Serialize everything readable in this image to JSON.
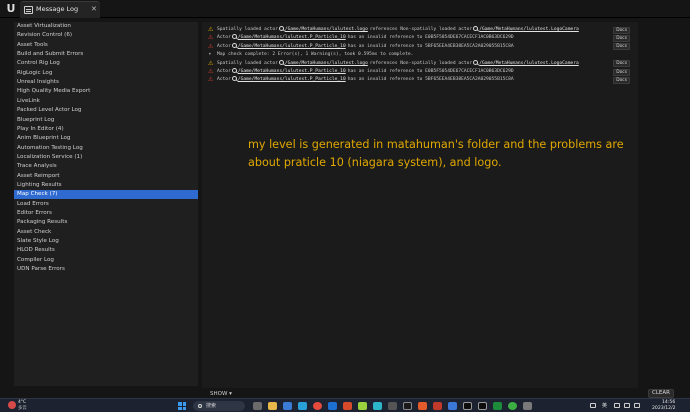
{
  "window": {
    "tab_label": "Message Log"
  },
  "sidebar": {
    "items": [
      "Asset Virtualization",
      "Revision Control (6)",
      "Asset Tools",
      "Build and Submit Errors",
      "Control Rig Log",
      "RigLogic Log",
      "Unreal Insights",
      "High Quality Media Export",
      "LiveLink",
      "Packed Level Actor Log",
      "Blueprint Log",
      "Play In Editor (4)",
      "Anim Blueprint Log",
      "Automation Testing Log",
      "Localization Service (1)",
      "Trace Analysis",
      "Asset Reimport",
      "Lighting Results",
      "Map Check (7)",
      "Load Errors",
      "Editor Errors",
      "Packaging Results",
      "Asset Check",
      "Slate Style Log",
      "HLOD Results",
      "Compiler Log",
      "UDN Parse Errors"
    ],
    "selected_index": 18
  },
  "log": {
    "docs_label": "Docs",
    "rows": [
      {
        "severity": "warning",
        "prefix": "Spatially loaded actor",
        "link1": "/Game/MetaHumans/lulutest.logo",
        "middle": "references Non-spatially loaded actor",
        "link2": "/Game/MetaHumans/lulutest.LogoCamera",
        "docs": true
      },
      {
        "severity": "error",
        "prefix": "Actor",
        "link1": "/Game/MetaHumans/lulutest.P_Particle_10",
        "middle": "has an invalid reference to E0B5F5054DE67CACECF1AC0B63DC629D",
        "link2": "",
        "docs": true
      },
      {
        "severity": "error",
        "prefix": "Actor",
        "link1": "/Game/MetaHumans/lulutest.P_Particle_10",
        "middle": "has an invalid reference to 5BF65EEA4EB38EA5CA2A029055B15C8A",
        "link2": "",
        "docs": true
      },
      {
        "severity": "info",
        "prefix": "Map check complete: 2 Error(s), 1 Warning(s), took 0.595ms to complete.",
        "link1": "",
        "middle": "",
        "link2": "",
        "docs": false
      },
      {
        "severity": "warning",
        "prefix": "Spatially loaded actor",
        "link1": "/Game/MetaHumans/lulutest.logo",
        "middle": "references Non-spatially loaded actor",
        "link2": "/Game/MetaHumans/lulutest.LogoCamera",
        "docs": true
      },
      {
        "severity": "error",
        "prefix": "Actor",
        "link1": "/Game/MetaHumans/lulutest.P_Particle_10",
        "middle": "has an invalid reference to E0B5F5054DE67CACECF1AC0B63DC629D",
        "link2": "",
        "docs": true
      },
      {
        "severity": "error",
        "prefix": "Actor",
        "link1": "/Game/MetaHumans/lulutest.P_Particle_10",
        "middle": "has an invalid reference to 5BF65EEA4EB38EA5CA2A029055B15C8A",
        "link2": "",
        "docs": true
      }
    ],
    "annotation": "my level is generated  in matahuman's folder and the problems are about praticle 10 (niagara system), and logo."
  },
  "controls": {
    "show_label": "SHOW ▾",
    "clear_label": "CLEAR"
  },
  "taskbar": {
    "temperature": "4°C",
    "weather_desc": "多云",
    "search_placeholder": "搜索",
    "language": "英",
    "time": "14:56",
    "date": "2023/12/2"
  },
  "colors": {
    "selection": "#2f6ad1",
    "warning": "#e8b400",
    "error": "#e03b2e",
    "annotation": "#e0a800"
  }
}
